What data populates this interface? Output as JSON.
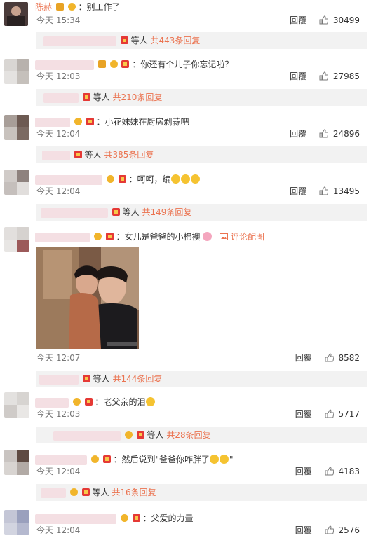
{
  "comments": [
    {
      "author": "陈赫",
      "text": "：别工作了",
      "date": "今天",
      "time": "15:34",
      "reply": "回覆",
      "likes": "30499"
    },
    {
      "author": "",
      "text": "：你还有个儿子你忘记啦？",
      "date": "今天",
      "time": "12:03",
      "reply": "回覆",
      "likes": "27985"
    },
    {
      "author": "",
      "text": "：小花妹妹在厨房剥蒜吧",
      "date": "今天",
      "time": "12:04",
      "reply": "回覆",
      "likes": "24896"
    },
    {
      "author": "",
      "text": "：呵呵，编",
      "date": "今天",
      "time": "12:04",
      "reply": "回覆",
      "likes": "13495"
    },
    {
      "author": "",
      "text": "：女儿是爸爸的小棉襖",
      "pic_label": "评论配图",
      "date": "今天",
      "time": "12:07",
      "reply": "回覆",
      "likes": "8582"
    },
    {
      "author": "",
      "text": "：老父亲的泪",
      "date": "今天",
      "time": "12:03",
      "reply": "回覆",
      "likes": "5717"
    },
    {
      "author": "",
      "text": "：然后说到\"爸爸你咋胖了",
      "text_end": "\"",
      "date": "今天",
      "time": "12:04",
      "reply": "回覆",
      "likes": "4183"
    },
    {
      "author": "",
      "text": "：父爱的力量",
      "date": "今天",
      "time": "12:04",
      "reply": "回覆",
      "likes": "2576"
    }
  ],
  "subs": [
    {
      "prefix": "等人",
      "count": "共443条回复"
    },
    {
      "prefix": "等人",
      "count": "共210条回复"
    },
    {
      "prefix": "等人",
      "count": "共385条回复"
    },
    {
      "prefix": "等人",
      "count": "共149条回复"
    },
    {
      "prefix": "等人",
      "count": "共144条回复"
    },
    {
      "prefix": "等人",
      "count": "共28条回复"
    },
    {
      "prefix": "等人",
      "count": "共16条回复"
    }
  ],
  "icons": {
    "like": "thumbs-up-icon",
    "verified": "verified-badge-icon",
    "vip": "vip-crown-icon",
    "medal": "medal-badge-icon",
    "pic": "image-icon"
  },
  "colors": {
    "accent": "#eb7350",
    "badge_red": "#e53935",
    "badge_gold": "#e8a325",
    "sub_bg": "#f2f2f2"
  }
}
